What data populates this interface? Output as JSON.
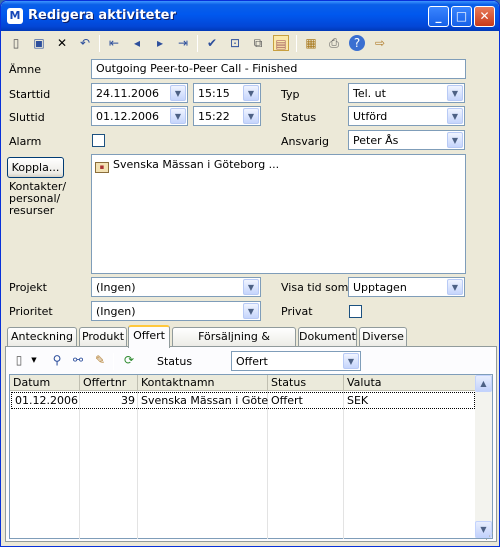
{
  "window": {
    "title": "Redigera aktiviteter",
    "app_icon_letter": "M"
  },
  "form": {
    "subject": {
      "label": "Ämne",
      "value": "Outgoing Peer-to-Peer Call - Finished"
    },
    "start": {
      "label": "Starttid",
      "date": "24.11.2006",
      "time": "15:15"
    },
    "end": {
      "label": "Sluttid",
      "date": "01.12.2006",
      "time": "15:22"
    },
    "alarm": {
      "label": "Alarm",
      "checked": false
    },
    "type": {
      "label": "Typ",
      "value": "Tel. ut"
    },
    "status": {
      "label": "Status",
      "value": "Utförd"
    },
    "responsible": {
      "label": "Ansvarig",
      "value": "Peter Ås"
    },
    "link_button": "Koppla...",
    "contacts_label": "Kontakter/\npersonal/\nresurser",
    "contacts": [
      {
        "name": "Svenska Mässan i Göteborg ..."
      }
    ],
    "project": {
      "label": "Projekt",
      "value": "(Ingen)"
    },
    "show_time_as": {
      "label": "Visa tid som",
      "value": "Upptagen"
    },
    "priority": {
      "label": "Prioritet",
      "value": "(Ingen)"
    },
    "private": {
      "label": "Privat",
      "checked": false
    }
  },
  "tabs": [
    {
      "label": "Anteckning"
    },
    {
      "label": "Produkt"
    },
    {
      "label": "Offert"
    },
    {
      "label": "Försäljning & fakturering"
    },
    {
      "label": "Dokument"
    },
    {
      "label": "Diverse"
    }
  ],
  "active_tab": "Offert",
  "offer_tab": {
    "status_label": "Status",
    "status_value": "Offert",
    "columns": [
      "Datum",
      "Offertnr",
      "Kontaktnamn",
      "Status",
      "Valuta"
    ],
    "rows": [
      {
        "date": "01.12.2006",
        "number": "39",
        "contact": "Svenska Mässan i Götebo",
        "status": "Offert",
        "currency": "SEK"
      }
    ]
  },
  "colors": {
    "titlebar": "#0058ee",
    "window_bg": "#ece9d8",
    "tab_highlight": "#ffc83c"
  }
}
